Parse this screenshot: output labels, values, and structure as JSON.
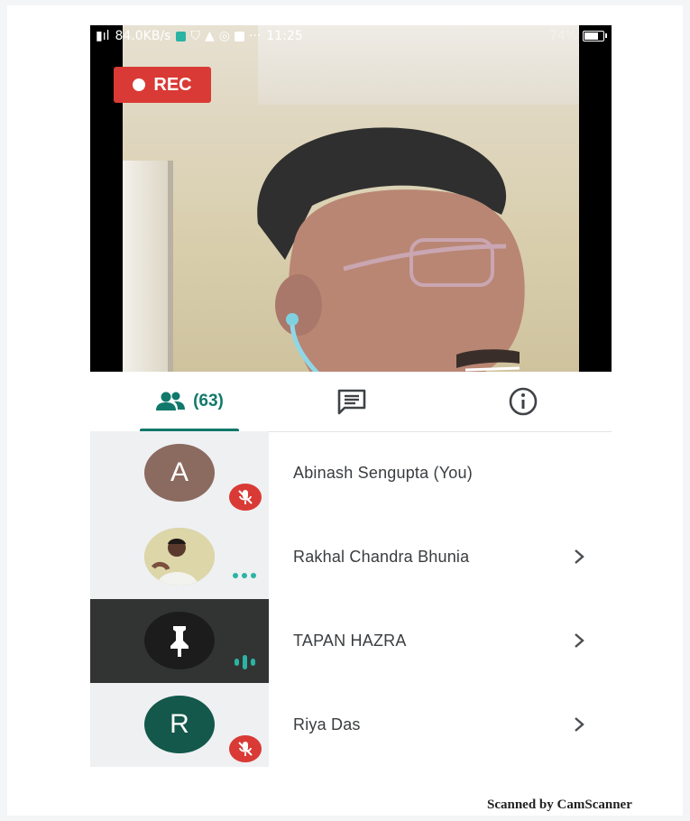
{
  "status_bar": {
    "speed": "84.0KB/s",
    "time": "11:25",
    "battery": "74%"
  },
  "video": {
    "rec_label": "REC"
  },
  "tabs": {
    "people_count": "(63)",
    "people_icon": "people-icon",
    "chat_icon": "chat-icon",
    "info_icon": "info-icon",
    "active": "people"
  },
  "participants": [
    {
      "name": "Abinash Sengupta (You)",
      "initial": "A",
      "avatar_color": "#8b6a60",
      "status": "muted",
      "has_chevron": false
    },
    {
      "name": "Rakhal Chandra Bhunia",
      "initial": "",
      "avatar_color": "#d9c98f",
      "status": "more",
      "has_chevron": true
    },
    {
      "name": "TAPAN HAZRA",
      "initial": "",
      "avatar_color": "#1c1c1c",
      "status": "speaking",
      "has_chevron": true
    },
    {
      "name": "Riya Das",
      "initial": "R",
      "avatar_color": "#13584a",
      "status": "muted",
      "has_chevron": true
    }
  ],
  "colors": {
    "accent": "#11796b",
    "rec_red": "#d93a35",
    "speaking_teal": "#2bb3a3"
  },
  "footer": {
    "scanner_text": "Scanned by CamScanner"
  }
}
